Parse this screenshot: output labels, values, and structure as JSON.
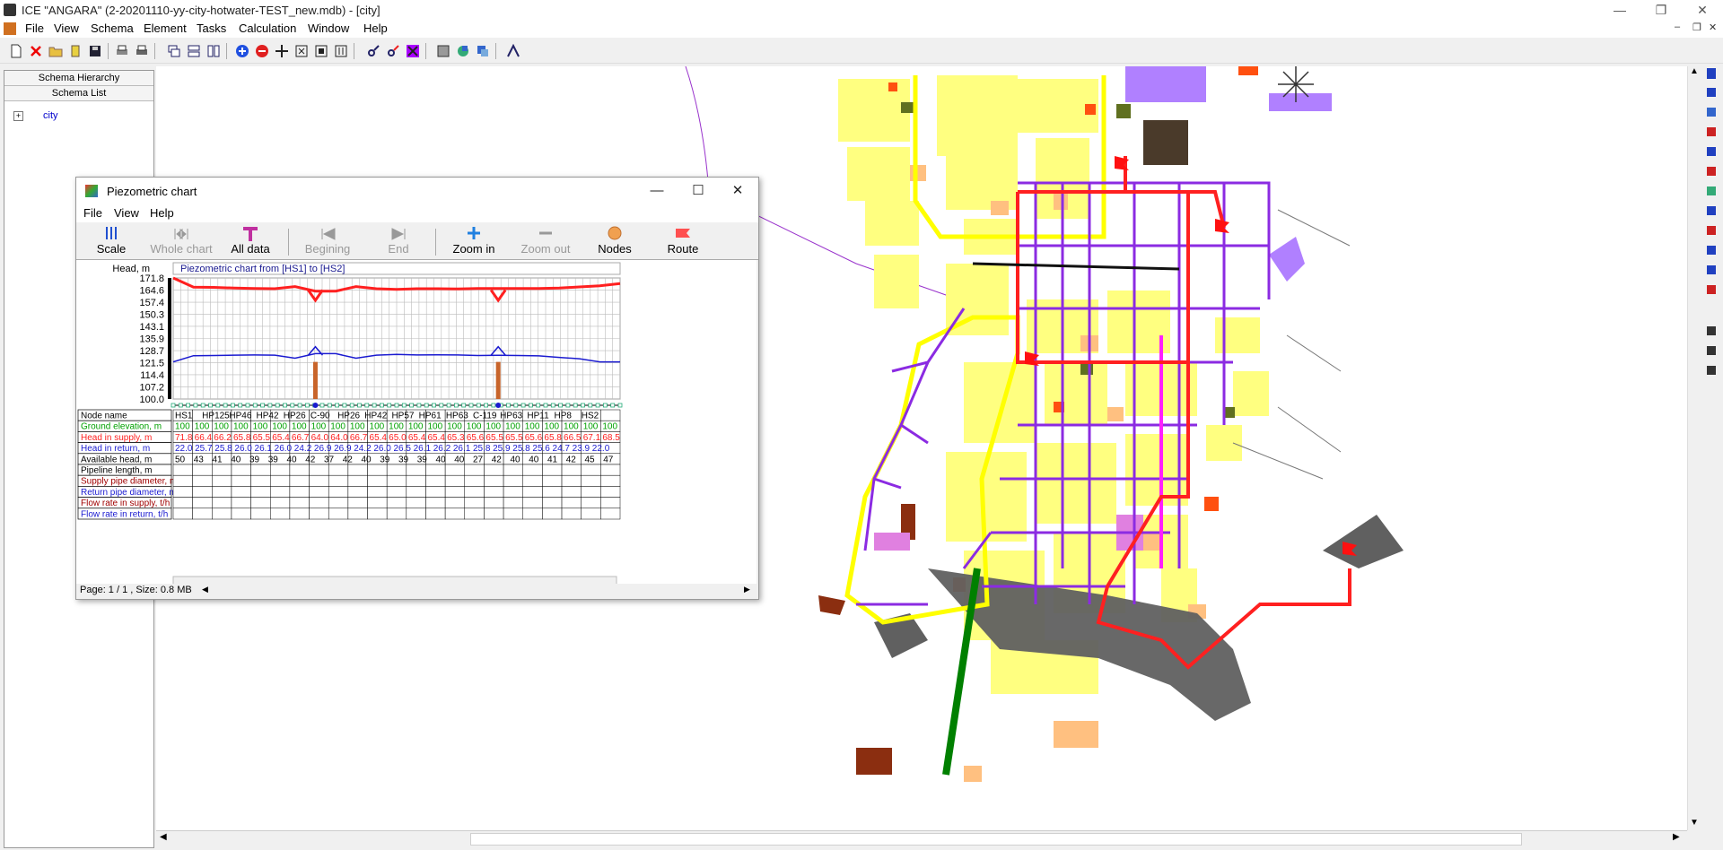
{
  "window": {
    "title": "ICE \"ANGARA\" (2-20201110-yy-city-hotwater-TEST_new.mdb) - [city]"
  },
  "menu": [
    "File",
    "View",
    "Schema",
    "Element",
    "Tasks",
    "Calculation",
    "Window",
    "Help"
  ],
  "left_panel": {
    "hierarchy_label": "Schema Hierarchy",
    "list_label": "Schema List",
    "tree_item": "city"
  },
  "colors": {
    "supply": "#ff2020",
    "return": "#1a1ad0",
    "ground": "#00a000",
    "pipe_purple": "#8b2be2",
    "building_yellow": "#ffff80"
  },
  "piezo": {
    "title": "Piezometric chart",
    "menu": [
      "File",
      "View",
      "Help"
    ],
    "toolbar": [
      {
        "label": "Scale",
        "icon": "scale-icon",
        "enabled": true
      },
      {
        "label": "Whole chart",
        "icon": "whole-chart-icon",
        "enabled": false
      },
      {
        "label": "All data",
        "icon": "all-data-icon",
        "enabled": true
      },
      {
        "label": "Begining",
        "icon": "begin-icon",
        "enabled": false
      },
      {
        "label": "End",
        "icon": "end-icon",
        "enabled": false
      },
      {
        "label": "Zoom in",
        "icon": "zoom-in-icon",
        "enabled": true
      },
      {
        "label": "Zoom out",
        "icon": "zoom-out-icon",
        "enabled": false
      },
      {
        "label": "Nodes",
        "icon": "nodes-icon",
        "enabled": true
      },
      {
        "label": "Route",
        "icon": "route-flag-icon",
        "enabled": true
      }
    ],
    "status": "Page: 1 / 1 , Size: 0.8 MB"
  },
  "chart_data": {
    "type": "line",
    "title": "Piezometric chart from [HS1] to [HS2]",
    "ylabel": "Head, m",
    "yticks": [
      171.8,
      164.6,
      157.4,
      150.3,
      143.1,
      135.9,
      128.7,
      121.5,
      114.4,
      107.2,
      100.0
    ],
    "ylim": [
      100.0,
      171.8
    ],
    "grid": true,
    "series": [
      {
        "name": "Head in supply, m",
        "color": "#ff2020",
        "values": [
          171.8,
          166.4,
          166.2,
          165.8,
          165.5,
          165.4,
          166.7,
          164.0,
          164.0,
          166.7,
          165.4,
          165.0,
          165.4,
          165.4,
          165.3,
          165.6,
          165.5,
          165.5,
          165.6,
          165.8,
          166.5,
          167.1,
          168.5
        ]
      },
      {
        "name": "Head in return, m",
        "color": "#1a1ad0",
        "values": [
          122.0,
          125.7,
          125.8,
          126.0,
          126.1,
          126.0,
          124.2,
          126.9,
          126.9,
          124.2,
          126.0,
          126.5,
          126.1,
          126.2,
          126.1,
          125.8,
          125.9,
          125.8,
          125.6,
          124.7,
          123.9,
          122.0,
          122.0
        ]
      }
    ],
    "peaks": [
      {
        "label": "C-90",
        "supply": 158.5,
        "return": 131.0,
        "bar_top": 122.0
      },
      {
        "label": "C-119",
        "supply": 158.5,
        "return": 131.0,
        "bar_top": 122.0
      }
    ],
    "table": {
      "row_labels": [
        "Node name",
        "Ground elevation, m",
        "Head in supply, m",
        "Head in return, m",
        "Available head, m",
        "Pipeline length, m",
        "Supply pipe diameter, mm",
        "Return pipe diameter, mm",
        "Flow rate in supply, t/h",
        "Flow rate in return, t/h"
      ],
      "row_colors": [
        "#000",
        "#00a000",
        "#ff2020",
        "#1a1ad0",
        "#000",
        "#000",
        "#a00000",
        "#1a1ad0",
        "#a00000",
        "#1a1ad0"
      ],
      "nodes": [
        "HS1",
        "HP125",
        "HP46",
        "HP42",
        "HP26",
        "C-90",
        "HP26",
        "HP42",
        "HP57",
        "HP61",
        "HP63",
        "C-119",
        "HP63",
        "HP11",
        "HP8",
        "HS2"
      ],
      "ground": [
        "100",
        "100",
        "100",
        "100",
        "100",
        "100",
        "100",
        "100",
        "100",
        "100",
        "100",
        "100",
        "100",
        "100",
        "100",
        "100",
        "100",
        "100",
        "100",
        "100",
        "100",
        "100",
        "100"
      ],
      "supply": [
        "71.8",
        "66.4",
        "66.2",
        "65.8",
        "65.5",
        "65.4",
        "66.7",
        "64.0",
        "64.0",
        "66.7",
        "65.4",
        "65.0",
        "65.4",
        "65.4",
        "65.3",
        "65.6",
        "65.5",
        "65.5",
        "65.6",
        "65.8",
        "66.5",
        "67.1",
        "68.5"
      ],
      "return": [
        "22.0",
        "25.7",
        "25.8",
        "26.0",
        "26.1",
        "26.0",
        "24.2",
        "26.9",
        "26.9",
        "24.2",
        "26.0",
        "26.5",
        "26.1",
        "26.2",
        "26.1",
        "25.8",
        "25.9",
        "25.8",
        "25.6",
        "24.7",
        "23.9",
        "22.0"
      ],
      "available": [
        "50",
        "43",
        "41",
        "40",
        "39",
        "39",
        "40",
        "42",
        "37",
        "42",
        "40",
        "39",
        "39",
        "39",
        "40",
        "40",
        "27",
        "42",
        "40",
        "40",
        "41",
        "42",
        "45",
        "47"
      ]
    }
  }
}
